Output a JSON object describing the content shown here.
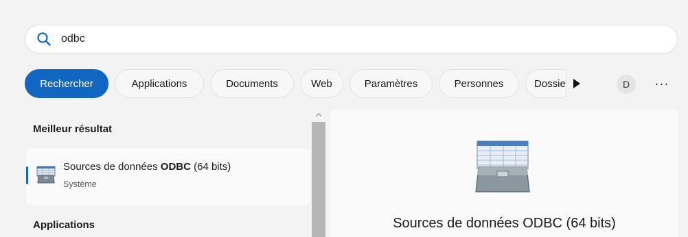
{
  "search": {
    "value": "odbc"
  },
  "filters": {
    "chips": [
      {
        "label": "Rechercher",
        "active": true
      },
      {
        "label": "Applications",
        "active": false
      },
      {
        "label": "Documents",
        "active": false
      },
      {
        "label": "Web",
        "active": false
      },
      {
        "label": "Paramètres",
        "active": false
      },
      {
        "label": "Personnes",
        "active": false
      },
      {
        "label": "Dossiers",
        "active": false
      }
    ],
    "more_icon": "play-arrow-icon",
    "avatar_letter": "D",
    "overflow_label": "···"
  },
  "results": {
    "best_match_title": "Meilleur résultat",
    "best_match": {
      "title_prefix": "Sources de données ",
      "title_match": "ODBC",
      "title_suffix": " (64 bits)",
      "subtitle": "Système",
      "icon": "odbc-toolbox-icon"
    },
    "apps_section_title": "Applications"
  },
  "preview": {
    "title": "Sources de données ODBC (64 bits)",
    "icon": "odbc-toolbox-icon"
  },
  "colors": {
    "accent": "#1166c2",
    "background": "#f3f3f3"
  }
}
